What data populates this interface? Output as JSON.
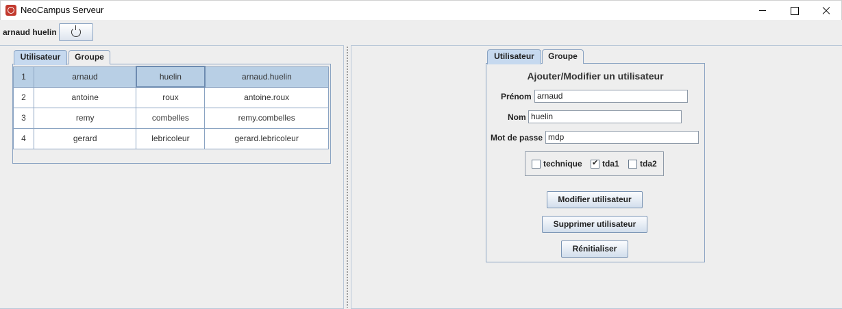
{
  "window": {
    "title": "NeoCampus Serveur",
    "icon": "app-logo-icon"
  },
  "user_bar": {
    "user_name": "arnaud huelin",
    "logout_icon": "power-icon"
  },
  "left_panel": {
    "tabs": [
      {
        "label": "Utilisateur",
        "active": true
      },
      {
        "label": "Groupe",
        "active": false
      }
    ],
    "table": {
      "rows": [
        {
          "id": "1",
          "prenom": "arnaud",
          "nom": "huelin",
          "login": "arnaud.huelin",
          "selected": true
        },
        {
          "id": "2",
          "prenom": "antoine",
          "nom": "roux",
          "login": "antoine.roux",
          "selected": false
        },
        {
          "id": "3",
          "prenom": "remy",
          "nom": "combelles",
          "login": "remy.combelles",
          "selected": false
        },
        {
          "id": "4",
          "prenom": "gerard",
          "nom": "lebricoleur",
          "login": "gerard.lebricoleur",
          "selected": false
        }
      ]
    }
  },
  "right_panel": {
    "tabs": [
      {
        "label": "Utilisateur",
        "active": true
      },
      {
        "label": "Groupe",
        "active": false
      }
    ],
    "form": {
      "title": "Ajouter/Modifier un utilisateur",
      "prenom_label": "Prénom",
      "prenom_value": "arnaud",
      "nom_label": "Nom",
      "nom_value": "huelin",
      "password_label": "Mot de passe",
      "password_value": "mdp",
      "groups": [
        {
          "label": "technique",
          "checked": false
        },
        {
          "label": "tda1",
          "checked": true
        },
        {
          "label": "tda2",
          "checked": false
        }
      ],
      "modify_button": "Modifier utilisateur",
      "delete_button": "Supprimer utilisateur",
      "reset_button": "Rénitialiser"
    }
  }
}
